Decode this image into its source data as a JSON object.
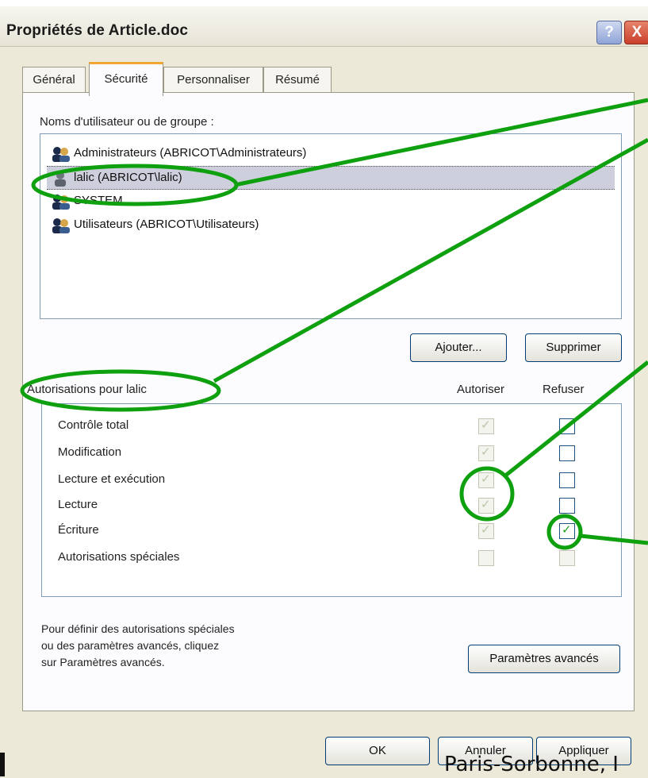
{
  "window": {
    "title": "Propriétés de Article.doc",
    "help_label": "?",
    "close_label": "X"
  },
  "tabs": [
    {
      "label": "Général",
      "active": false
    },
    {
      "label": "Sécurité",
      "active": true
    },
    {
      "label": "Personnaliser",
      "active": false
    },
    {
      "label": "Résumé",
      "active": false
    }
  ],
  "users": {
    "heading": "Noms d'utilisateur ou de groupe :",
    "items": [
      {
        "label": "Administrateurs (ABRICOT\\Administrateurs)",
        "icon": "group-icon",
        "selected": false
      },
      {
        "label": "lalic (ABRICOT\\lalic)",
        "icon": "user-icon",
        "selected": true
      },
      {
        "label": "SYSTEM",
        "icon": "group-icon",
        "selected": false
      },
      {
        "label": "Utilisateurs (ABRICOT\\Utilisateurs)",
        "icon": "group-icon",
        "selected": false
      }
    ],
    "add_label": "Ajouter...",
    "remove_label": "Supprimer"
  },
  "permissions": {
    "heading": "Autorisations pour lalic",
    "col_allow": "Autoriser",
    "col_deny": "Refuser",
    "rows": [
      {
        "label": "Contrôle total",
        "allow": "disabled-checked",
        "deny": "unchecked"
      },
      {
        "label": "Modification",
        "allow": "disabled-checked",
        "deny": "unchecked"
      },
      {
        "label": "Lecture et exécution",
        "allow": "disabled-checked",
        "deny": "unchecked"
      },
      {
        "label": "Lecture",
        "allow": "disabled-checked",
        "deny": "unchecked"
      },
      {
        "label": "Écriture",
        "allow": "disabled-checked",
        "deny": "checked"
      },
      {
        "label": "Autorisations spéciales",
        "allow": "disabled-unchecked",
        "deny": "disabled-unchecked"
      }
    ]
  },
  "advanced": {
    "text_line1": "Pour définir des autorisations spéciales",
    "text_line2": "ou des paramètres avancés, cliquez",
    "text_line3": "sur Paramètres avancés.",
    "button_label": "Paramètres avancés"
  },
  "dialog_buttons": {
    "ok_label": "OK",
    "cancel_label": "Annuler",
    "apply_label": "Appliquer"
  },
  "footer": {
    "text": "Paris-Sorbonne, I"
  },
  "colors": {
    "annotation": "#0fa00f",
    "check_green": "#21a121"
  }
}
